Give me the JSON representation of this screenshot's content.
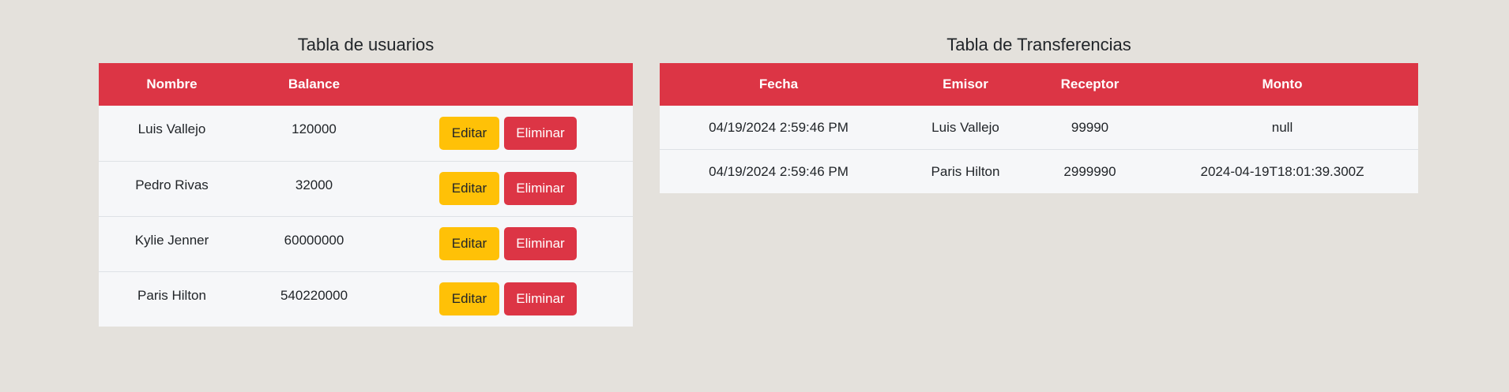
{
  "users_table": {
    "title": "Tabla de usuarios",
    "headers": [
      "Nombre",
      "Balance",
      ""
    ],
    "rows": [
      {
        "nombre": "Luis Vallejo",
        "balance": "120000"
      },
      {
        "nombre": "Pedro Rivas",
        "balance": "32000"
      },
      {
        "nombre": "Kylie Jenner",
        "balance": "60000000"
      },
      {
        "nombre": "Paris Hilton",
        "balance": "540220000"
      }
    ],
    "edit_label": "Editar",
    "delete_label": "Eliminar"
  },
  "transfers_table": {
    "title": "Tabla de Transferencias",
    "headers": [
      "Fecha",
      "Emisor",
      "Receptor",
      "Monto"
    ],
    "rows": [
      {
        "fecha": "04/19/2024 2:59:46 PM",
        "emisor": "Luis Vallejo",
        "receptor": "99990",
        "monto": "null"
      },
      {
        "fecha": "04/19/2024 2:59:46 PM",
        "emisor": "Paris Hilton",
        "receptor": "2999990",
        "monto": "2024-04-19T18:01:39.300Z"
      }
    ]
  },
  "colors": {
    "background": "#e4e1dc",
    "header": "#dc3545",
    "edit_button": "#ffc107",
    "delete_button": "#dc3545",
    "row": "#f6f7f9"
  }
}
